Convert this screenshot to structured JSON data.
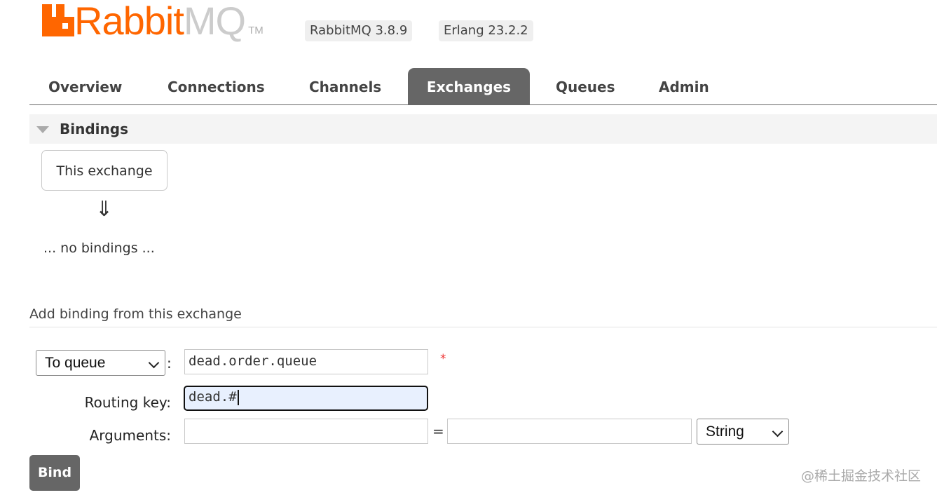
{
  "header": {
    "logo_word_rabbit": "Rabbit",
    "logo_word_mq": "MQ",
    "logo_tm": "TM",
    "rabbitmq_version": "RabbitMQ 3.8.9",
    "erlang_version": "Erlang 23.2.2"
  },
  "tabs": [
    {
      "label": "Overview",
      "active": false
    },
    {
      "label": "Connections",
      "active": false
    },
    {
      "label": "Channels",
      "active": false
    },
    {
      "label": "Exchanges",
      "active": true
    },
    {
      "label": "Queues",
      "active": false
    },
    {
      "label": "Admin",
      "active": false
    }
  ],
  "bindings": {
    "section_title": "Bindings",
    "this_exchange_label": "This exchange",
    "arrow_glyph": "⇓",
    "empty_text": "... no bindings ..."
  },
  "add_binding": {
    "title": "Add binding from this exchange",
    "destination_type": "To queue",
    "colon": ":",
    "destination_value": "dead.order.queue",
    "required_marker": "*",
    "routing_key_label": "Routing key:",
    "routing_key_value": "dead.#",
    "arguments_label": "Arguments:",
    "equals": "=",
    "argument_key_value": "",
    "argument_value_value": "",
    "argument_type": "String",
    "bind_button": "Bind"
  },
  "watermark": "@稀土掘金技术社区",
  "colors": {
    "brand_orange": "#ff6600",
    "tab_active_bg": "#666666",
    "required": "#ee3333"
  },
  "icons": [
    "rabbitmq-logo-icon",
    "collapse-triangle-icon",
    "down-arrow-icon",
    "chevron-down-icon"
  ]
}
